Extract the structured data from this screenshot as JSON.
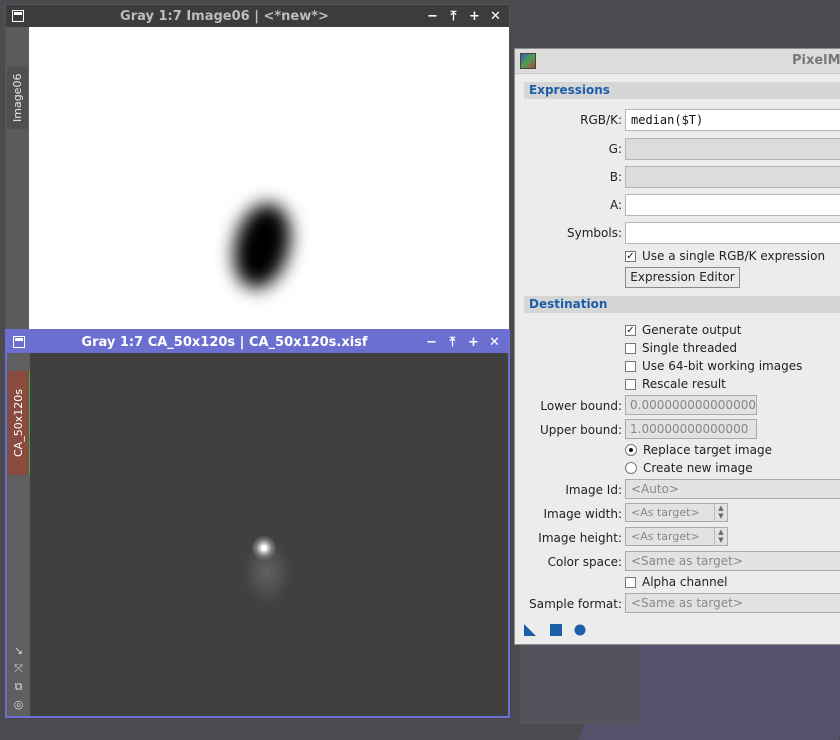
{
  "window1": {
    "title": "Gray 1:7 Image06 | <*new*>",
    "side_tab": "Image06",
    "controls": [
      "−",
      "⤒",
      "+",
      "✕"
    ]
  },
  "window2": {
    "title": "Gray 1:7 CA_50x120s | CA_50x120s.xisf",
    "side_tab": "CA_50x120s",
    "controls": [
      "−",
      "⤒",
      "+",
      "✕"
    ],
    "sidebar_icons": [
      "↘",
      "⤧",
      "⧉",
      "◎"
    ]
  },
  "pixelmath": {
    "title": "PixelMa",
    "expressions": {
      "section": "Expressions",
      "rgbk_label": "RGB/K:",
      "rgbk_value": "median($T)",
      "g_label": "G:",
      "b_label": "B:",
      "a_label": "A:",
      "symbols_label": "Symbols:",
      "single_rgbk": "Use a single RGB/K expression",
      "editor_button": "Expression Editor"
    },
    "destination": {
      "section": "Destination",
      "generate_output": "Generate output",
      "single_threaded": "Single threaded",
      "use_64bit": "Use 64-bit working images",
      "rescale": "Rescale result",
      "lower_label": "Lower bound:",
      "lower_value": "0.000000000000000",
      "upper_label": "Upper bound:",
      "upper_value": "1.00000000000000",
      "replace_target": "Replace target image",
      "create_new": "Create new image",
      "image_id_label": "Image Id:",
      "image_id_value": "<Auto>",
      "width_label": "Image width:",
      "width_value": "<As target>",
      "height_label": "Image height:",
      "height_value": "<As target>",
      "color_space_label": "Color space:",
      "color_space_value": "<Same as target>",
      "alpha_channel": "Alpha channel",
      "sample_format_label": "Sample format:",
      "sample_format_value": "<Same as target>"
    },
    "checked": {
      "single_rgbk": true,
      "generate_output": true,
      "single_threaded": false,
      "use_64bit": false,
      "rescale": false,
      "alpha_channel": false
    },
    "selected_radio": "replace_target"
  },
  "colors": {
    "accent_blue": "#1b5fa8",
    "active_titlebar": "#6a6fd0"
  }
}
